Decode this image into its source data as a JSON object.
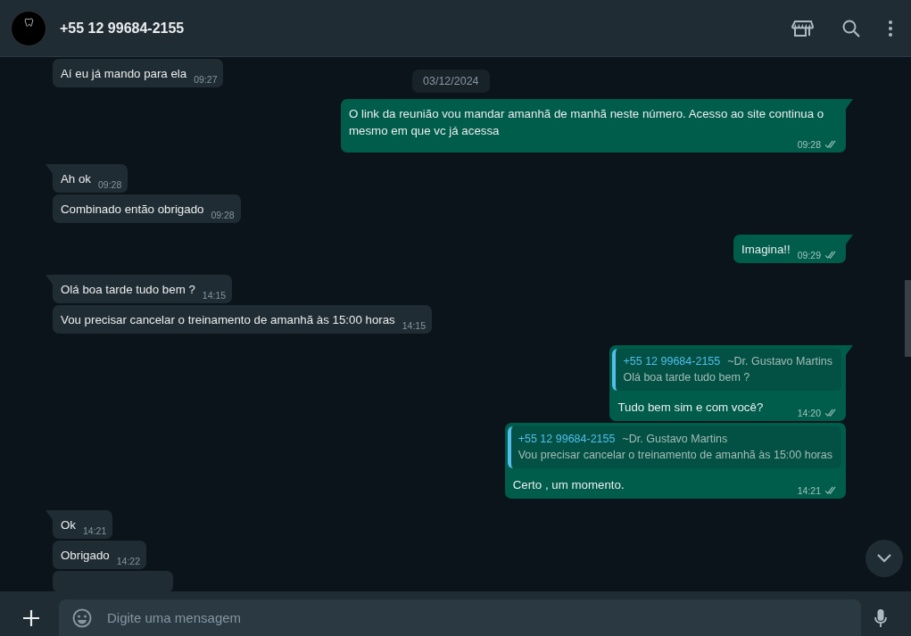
{
  "header": {
    "title": "+55 12 99684-2155"
  },
  "date_chip": "03/12/2024",
  "messages": [
    {
      "outgoing": false,
      "tail": false,
      "text": "Aí eu já mando para ela",
      "time": "09:27"
    },
    {
      "outgoing": true,
      "tail": true,
      "text": "O link da reunião vou mandar amanhã de manhã neste número. Acesso ao site continua o mesmo em que vc já acessa",
      "time": "09:28",
      "read": false
    },
    {
      "outgoing": false,
      "tail": true,
      "text": "Ah ok",
      "time": "09:28"
    },
    {
      "outgoing": false,
      "tail": false,
      "text": "Combinado então obrigado",
      "time": "09:28"
    },
    {
      "outgoing": true,
      "tail": true,
      "text": "Imagina!!",
      "time": "09:29",
      "read": false
    },
    {
      "outgoing": false,
      "tail": true,
      "text": "Olá boa tarde tudo bem ?",
      "time": "14:15"
    },
    {
      "outgoing": false,
      "tail": false,
      "text": "Vou precisar cancelar o treinamento de amanhã às 15:00 horas",
      "time": "14:15"
    },
    {
      "outgoing": true,
      "tail": true,
      "quote": {
        "author": "+55 12 99684-2155",
        "push_name": "~Dr. Gustavo Martins",
        "text": "Olá boa tarde tudo bem ?"
      },
      "text": "Tudo bem sim e com você?",
      "time": "14:20",
      "read": false
    },
    {
      "outgoing": true,
      "tail": false,
      "quote": {
        "author": "+55 12 99684-2155",
        "push_name": "~Dr. Gustavo Martins",
        "text": "Vou precisar cancelar o treinamento de amanhã às 15:00 horas"
      },
      "text": "Certo , um momento.",
      "time": "14:21",
      "read": false
    },
    {
      "outgoing": false,
      "tail": true,
      "text": "Ok",
      "time": "14:21"
    },
    {
      "outgoing": false,
      "tail": false,
      "text": "Obrigado",
      "time": "14:22"
    },
    {
      "outgoing": false,
      "tail": false,
      "cut_off": true
    }
  ],
  "composer": {
    "placeholder": "Digite uma mensagem"
  }
}
